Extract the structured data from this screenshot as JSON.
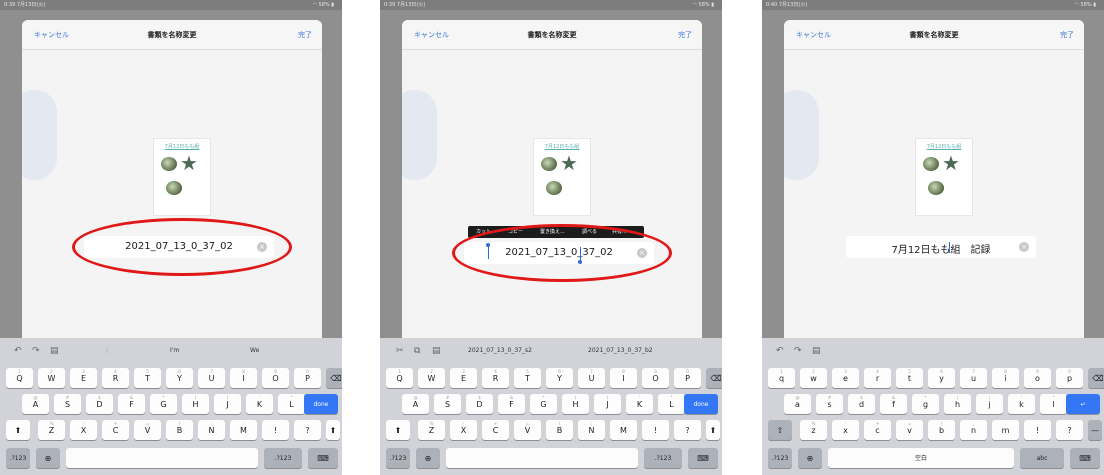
{
  "status_bar": [
    {
      "time": "0:39",
      "date": "7月13日(火)",
      "battery": "58%"
    },
    {
      "time": "0:39",
      "date": "7月13日(火)",
      "battery": "58%"
    },
    {
      "time": "0:40",
      "date": "7月13日(火)",
      "battery": "58%"
    }
  ],
  "dialog": {
    "cancel_label": "キャンセル",
    "title": "書類を名称変更",
    "done_label": "完了"
  },
  "thumbnail_label": "7月12日もも組",
  "panels": [
    {
      "filename": "2021_07_13_0_37_02",
      "suggestions": [
        "I'm",
        "We"
      ],
      "return_key": "done",
      "number_key": ".?123"
    },
    {
      "filename": "2021_07_13_0_37_02",
      "edit_menu": [
        "カット",
        "コピー",
        "置き換え...",
        "調べる",
        "共有..."
      ],
      "suggestions": [
        "2021_07_13_0_37_s2",
        "2021_07_13_0_37_b2"
      ],
      "return_key": "done",
      "number_key": ".?123"
    },
    {
      "filename": "7月12日もも組　記録",
      "space_key": "空白",
      "abc_key": "abc",
      "return_icon": "return-icon",
      "number_key": ".?123"
    }
  ],
  "keyboard": {
    "upper_rows": [
      [
        "Q",
        "W",
        "E",
        "R",
        "T",
        "Y",
        "U",
        "I",
        "O",
        "P"
      ],
      [
        "A",
        "S",
        "D",
        "F",
        "G",
        "H",
        "J",
        "K",
        "L"
      ],
      [
        "Z",
        "X",
        "C",
        "V",
        "B",
        "N",
        "M",
        "!",
        "?"
      ]
    ],
    "lower_rows": [
      [
        "q",
        "w",
        "e",
        "r",
        "t",
        "y",
        "u",
        "i",
        "o",
        "p"
      ],
      [
        "a",
        "s",
        "d",
        "f",
        "g",
        "h",
        "j",
        "k",
        "l"
      ],
      [
        "z",
        "x",
        "c",
        "v",
        "b",
        "n",
        "m",
        "!",
        "?"
      ]
    ],
    "hints": [
      [
        "1",
        "2",
        "3",
        "4",
        "5",
        "6",
        "7",
        "8",
        "9",
        "0"
      ],
      [
        "@",
        "#",
        "$",
        "&",
        "*",
        "(",
        ")",
        "'",
        "\""
      ],
      [
        "%",
        "-",
        "+",
        "=",
        "/",
        ";",
        ":",
        ",",
        "."
      ]
    ]
  },
  "annotation": {
    "oval_color": "#e01818"
  },
  "icons": [
    "undo-icon",
    "redo-icon",
    "paste-icon",
    "cut-icon",
    "copy-icon",
    "globe-icon",
    "keyboard-dismiss-icon",
    "shift-icon",
    "delete-icon",
    "clear-icon"
  ]
}
